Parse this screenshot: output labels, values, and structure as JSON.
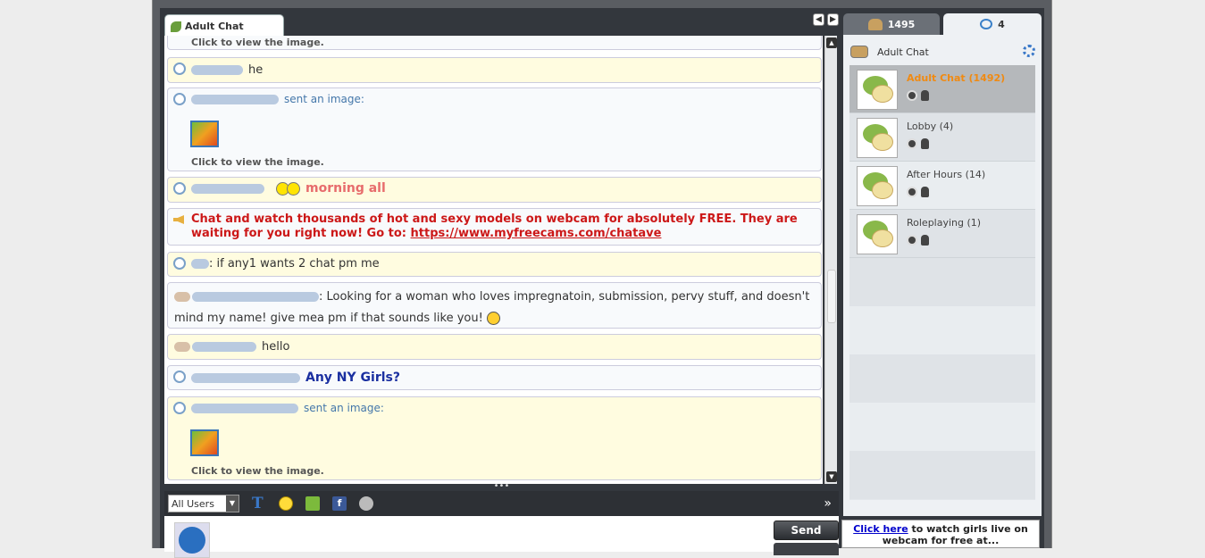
{
  "chat_tab": {
    "title": "Adult Chat"
  },
  "messages": {
    "top_caption": "Click to view the image.",
    "m1_text": "he",
    "m2_action": "sent an image:",
    "m2_caption": "Click to view the image.",
    "m3_text": "morning all",
    "promo_text": "Chat and watch thousands of hot and sexy models on webcam for absolutely FREE.  They are waiting for you right now! Go to: ",
    "promo_link": "https://www.myfreecams.com/chatave",
    "m5_text": ": if any1 wants 2 chat pm me",
    "m6_text": ": Looking for a woman who loves impregnatoin, submission, pervy stuff, and doesn't mind my name! give mea  pm if that sounds like you!",
    "m7_text": "hello",
    "m8_text": "Any NY Girls?",
    "m9_action": "sent an image:",
    "m9_caption": "Click to view the image."
  },
  "toolbar": {
    "recipient": "All Users",
    "font_label": "T",
    "fb_label": "f"
  },
  "input": {
    "send_label": "Send"
  },
  "right_panel": {
    "users_count": "1495",
    "rooms_count": "4",
    "header": "Adult Chat",
    "rooms": [
      {
        "name": "Adult Chat  (1492)"
      },
      {
        "name": "Lobby  (4)"
      },
      {
        "name": "After Hours  (14)"
      },
      {
        "name": "Roleplaying  (1)"
      }
    ]
  },
  "promo_box": {
    "link": "Click here",
    "text": " to watch girls live on webcam for free at..."
  },
  "colors": {
    "accent": "#f08a12",
    "promo": "#cc1818",
    "ny": "#1a2fa0",
    "morning": "#e76c6c"
  }
}
